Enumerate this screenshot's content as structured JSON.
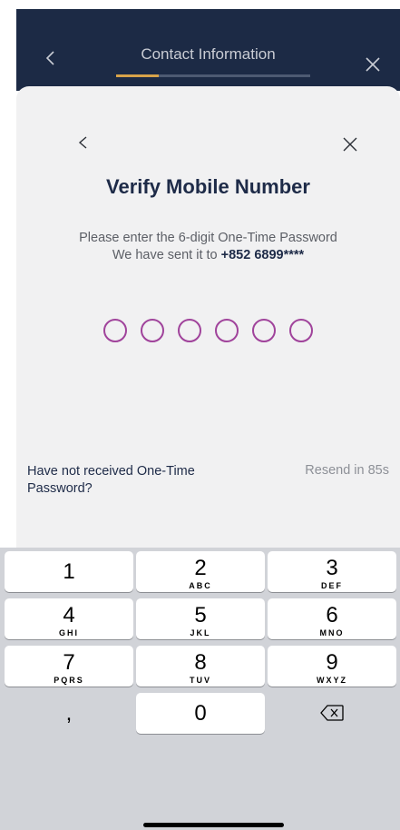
{
  "header": {
    "title": "Contact Information",
    "progress": 0.22,
    "back_icon": "chevron-left-icon",
    "close_icon": "close-icon"
  },
  "sheet": {
    "title": "Verify Mobile Number",
    "instruction_line1": "Please enter the 6-digit One-Time Password",
    "instruction_line2_prefix": "We have sent it to",
    "phone_masked": "+852 6899****",
    "otp_digits": 6,
    "resend_question": "Have not received One-Time Password?",
    "resend_timer": "Resend in 85s"
  },
  "keypad": {
    "k1": {
      "num": "1",
      "letters": ""
    },
    "k2": {
      "num": "2",
      "letters": "ABC"
    },
    "k3": {
      "num": "3",
      "letters": "DEF"
    },
    "k4": {
      "num": "4",
      "letters": "GHI"
    },
    "k5": {
      "num": "5",
      "letters": "JKL"
    },
    "k6": {
      "num": "6",
      "letters": "MNO"
    },
    "k7": {
      "num": "7",
      "letters": "PQRS"
    },
    "k8": {
      "num": "8",
      "letters": "TUV"
    },
    "k9": {
      "num": "9",
      "letters": "WXYZ"
    },
    "comma": ",",
    "k0": "0",
    "delete_icon": "backspace-icon"
  },
  "colors": {
    "header_bg": "#1c2a45",
    "accent": "#d8a34a",
    "otp_circle": "#a0439b",
    "title": "#1e2b48"
  }
}
